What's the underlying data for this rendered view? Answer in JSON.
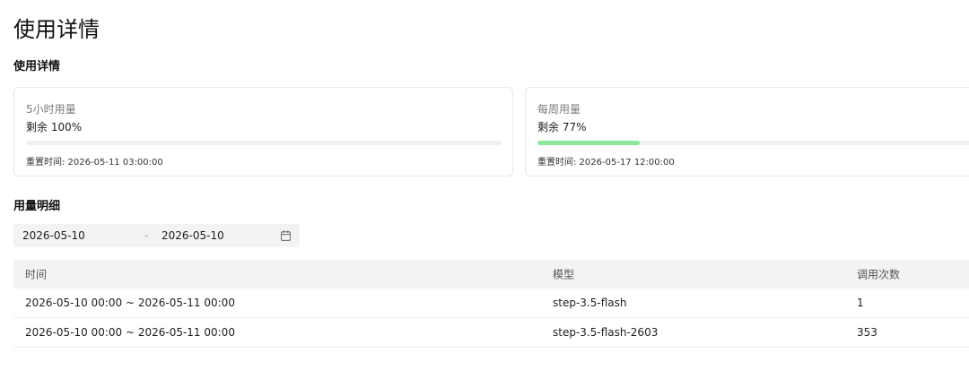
{
  "page": {
    "title": "使用详情"
  },
  "usage_section": {
    "title": "使用详情",
    "cards": [
      {
        "label": "5小时用量",
        "remaining": "剩余 100%",
        "used_fraction": 0.0,
        "bar_color": "#8ee89b",
        "reset": "重置时间: 2026-05-11 03:00:00"
      },
      {
        "label": "每周用量",
        "remaining": "剩余 77%",
        "used_fraction": 0.23,
        "bar_color": "#8ee89b",
        "reset": "重置时间: 2026-05-17 12:00:00"
      }
    ]
  },
  "detail_section": {
    "title": "用量明细",
    "date_range": {
      "start": "2026-05-10",
      "separator": "-",
      "end": "2026-05-10",
      "icon": "calendar-icon"
    },
    "table": {
      "columns": [
        "时间",
        "模型",
        "调用次数"
      ],
      "rows": [
        [
          "2026-05-10 00:00 ~ 2026-05-11 00:00",
          "step-3.5-flash",
          "1"
        ],
        [
          "2026-05-10 00:00 ~ 2026-05-11 00:00",
          "step-3.5-flash-2603",
          "353"
        ]
      ]
    }
  }
}
